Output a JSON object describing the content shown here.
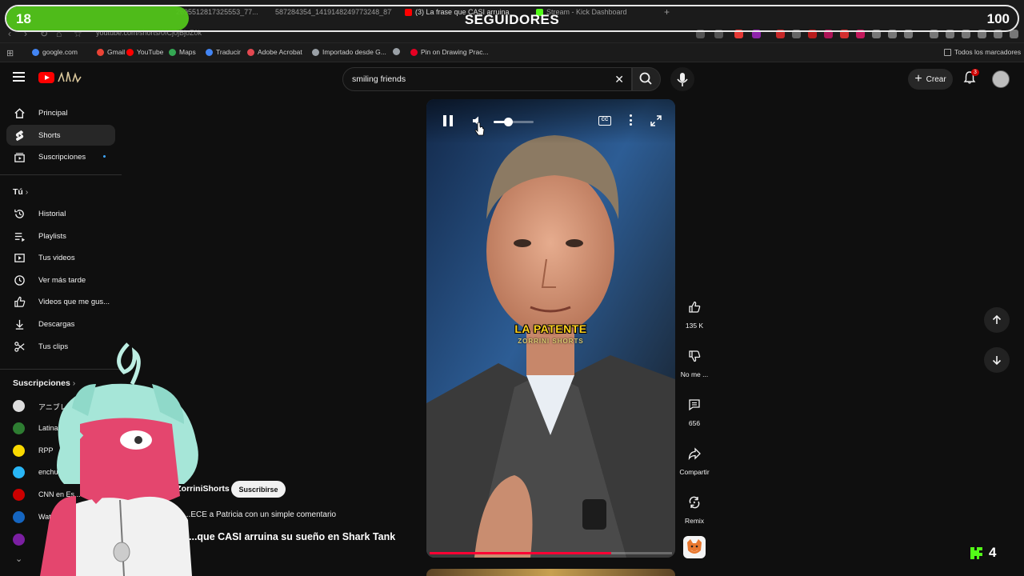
{
  "browser": {
    "tabs": [
      {
        "label": "2695512817325553_77..."
      },
      {
        "label": "587284354_1419148249773248_877..."
      },
      {
        "label": "(3) La frase que CASI arruina"
      },
      {
        "label": "Stream - Kick Dashboard"
      }
    ],
    "new_tab_label": "+",
    "url": "youtube.com/shorts/0fCj0jBjoZ0k",
    "bookmarks": [
      {
        "label": "google.com",
        "color": "#4285f4"
      },
      {
        "label": "Gmail",
        "color": "#ea4335"
      },
      {
        "label": "YouTube",
        "color": "#ff0000"
      },
      {
        "label": "Maps",
        "color": "#34a853"
      },
      {
        "label": "Traducir",
        "color": "#4285f4"
      },
      {
        "label": "Adobe Acrobat",
        "color": "#e34850"
      },
      {
        "label": "Importado desde G...",
        "color": "#9aa0a6"
      },
      {
        "label": "",
        "color": "#9aa0a6"
      },
      {
        "label": "Pin on Drawing Prac...",
        "color": "#e60023"
      }
    ],
    "all_bookmarks_label": "Todos los marcadores"
  },
  "overlay": {
    "followers_current": "18",
    "followers_goal": "100",
    "followers_fraction": 0.18,
    "title": "SEGUIDORES",
    "bar_color": "#52c41a",
    "kick_count": "4",
    "kick_color": "#53fc18"
  },
  "masthead": {
    "logo_icon": "youtube-logo-icon",
    "search_value": "smiling friends",
    "create_label": "Crear",
    "notification_count": "3"
  },
  "sidebar": {
    "items": [
      {
        "label": "Principal",
        "icon": "home-icon"
      },
      {
        "label": "Shorts",
        "icon": "shorts-icon"
      },
      {
        "label": "Suscripciones",
        "icon": "subscriptions-icon"
      }
    ],
    "you_header": "Tú",
    "you_items": [
      {
        "label": "Historial",
        "icon": "history-icon"
      },
      {
        "label": "Playlists",
        "icon": "playlist-icon"
      },
      {
        "label": "Tus videos",
        "icon": "video-icon"
      },
      {
        "label": "Ver más tarde",
        "icon": "clock-icon"
      },
      {
        "label": "Videos que me gus...",
        "icon": "thumbs-up-icon"
      },
      {
        "label": "Descargas",
        "icon": "download-icon"
      },
      {
        "label": "Tus clips",
        "icon": "scissors-icon"
      }
    ],
    "subs_header": "Suscripciones",
    "subscriptions": [
      {
        "label": "アニブレック...",
        "color": "#dddddd"
      },
      {
        "label": "Latina N...",
        "color": "#2e7d32"
      },
      {
        "label": "RPP",
        "color": "#f9d900"
      },
      {
        "label": "enchufe...",
        "color": "#29b6f6"
      },
      {
        "label": "CNN en Es...",
        "color": "#cc0000"
      },
      {
        "label": "Watch...",
        "color": "#1565c0"
      },
      {
        "label": "",
        "color": "#7b1fa2"
      }
    ]
  },
  "short": {
    "caption_main": "LA PATENTE",
    "caption_sub": "ZORRINI SHORTS",
    "volume_fraction": 0.35,
    "progress_fraction": 0.75,
    "channel_handle": "@ZorriniShorts",
    "subscribe_label": "Suscribirse",
    "description": "...ECE a Patricia con un simple comentario",
    "title": "...que CASI arruina su sueño en Shark Tank"
  },
  "actions": {
    "like_count": "135 K",
    "dislike_label": "No me ...",
    "comment_count": "656",
    "share_label": "Compartir",
    "remix_label": "Remix"
  }
}
